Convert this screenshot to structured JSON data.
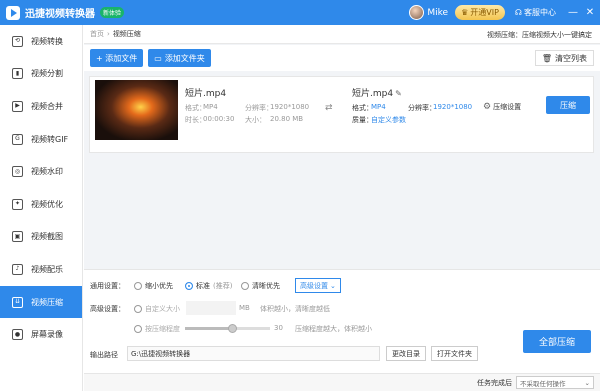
{
  "titlebar": {
    "app_title": "迅捷视频转换器",
    "version_badge": "新体验",
    "username": "Mike",
    "vip_label": "开通VIP",
    "service_label": "客服中心",
    "minimize": "—",
    "close": "✕"
  },
  "sidebar": {
    "items": [
      {
        "label": "视频转换",
        "icon": "convert-icon",
        "glyph": "⟲"
      },
      {
        "label": "视频分割",
        "icon": "split-icon",
        "glyph": "▮"
      },
      {
        "label": "视频合并",
        "icon": "merge-icon",
        "glyph": "▶"
      },
      {
        "label": "视频转GIF",
        "icon": "gif-icon",
        "glyph": "G"
      },
      {
        "label": "视频水印",
        "icon": "watermark-icon",
        "glyph": "◎"
      },
      {
        "label": "视频优化",
        "icon": "optimize-icon",
        "glyph": "✦"
      },
      {
        "label": "视频截图",
        "icon": "screenshot-icon",
        "glyph": "▣"
      },
      {
        "label": "视频配乐",
        "icon": "music-icon",
        "glyph": "♪"
      },
      {
        "label": "视频压缩",
        "icon": "compress-icon",
        "glyph": "⇊"
      },
      {
        "label": "屏幕录像",
        "icon": "record-icon",
        "glyph": "●"
      }
    ],
    "active_index": 8
  },
  "breadcrumb": {
    "home": "首页",
    "sep": "›",
    "current": "视频压缩",
    "hint": "视频压缩：压缩视频大小一键搞定"
  },
  "toolbar": {
    "add_file": "+ 添加文件",
    "add_folder": "添加文件夹",
    "clear_list": "清空列表"
  },
  "file": {
    "name": "短片.mp4",
    "format_label": "格式：",
    "format": "MP4",
    "resolution_label": "分辨率：",
    "resolution": "1920*1080",
    "duration_label": "时长：",
    "duration": "00:00:30",
    "size_label": "大小：",
    "size": "20.80 MB",
    "output_name": "短片.mp4",
    "output_format_label": "格式：",
    "output_format": "MP4",
    "output_resolution_label": "分辨率：",
    "output_resolution": "1920*1080",
    "quality_label": "质量：",
    "quality": "自定义参数",
    "settings_label": "压缩设置",
    "compress_label": "压缩"
  },
  "settings": {
    "general_label": "通用设置：",
    "opt_small": "缩小优先",
    "opt_standard": "标准",
    "opt_standard_note": "(推荐)",
    "opt_clear": "清晰优先",
    "adv_button": "高级设置",
    "advanced_label": "高级设置：",
    "custom_size": "自定义大小",
    "size_unit": "MB",
    "size_hint": "体积越小，清晰度越低",
    "ratio_label": "按压缩程度",
    "ratio_value": "30",
    "ratio_hint": "压缩程度越大，体积越小",
    "ratio_fraction": 0.55,
    "output_path_label": "输出路径",
    "output_path": "G:\\迅捷视频转换器",
    "change_dir": "更改目录",
    "open_folder": "打开文件夹",
    "compress_all": "全部压缩"
  },
  "status": {
    "on_complete_label": "任务完成后",
    "on_complete_value": "不采取任何操作"
  }
}
